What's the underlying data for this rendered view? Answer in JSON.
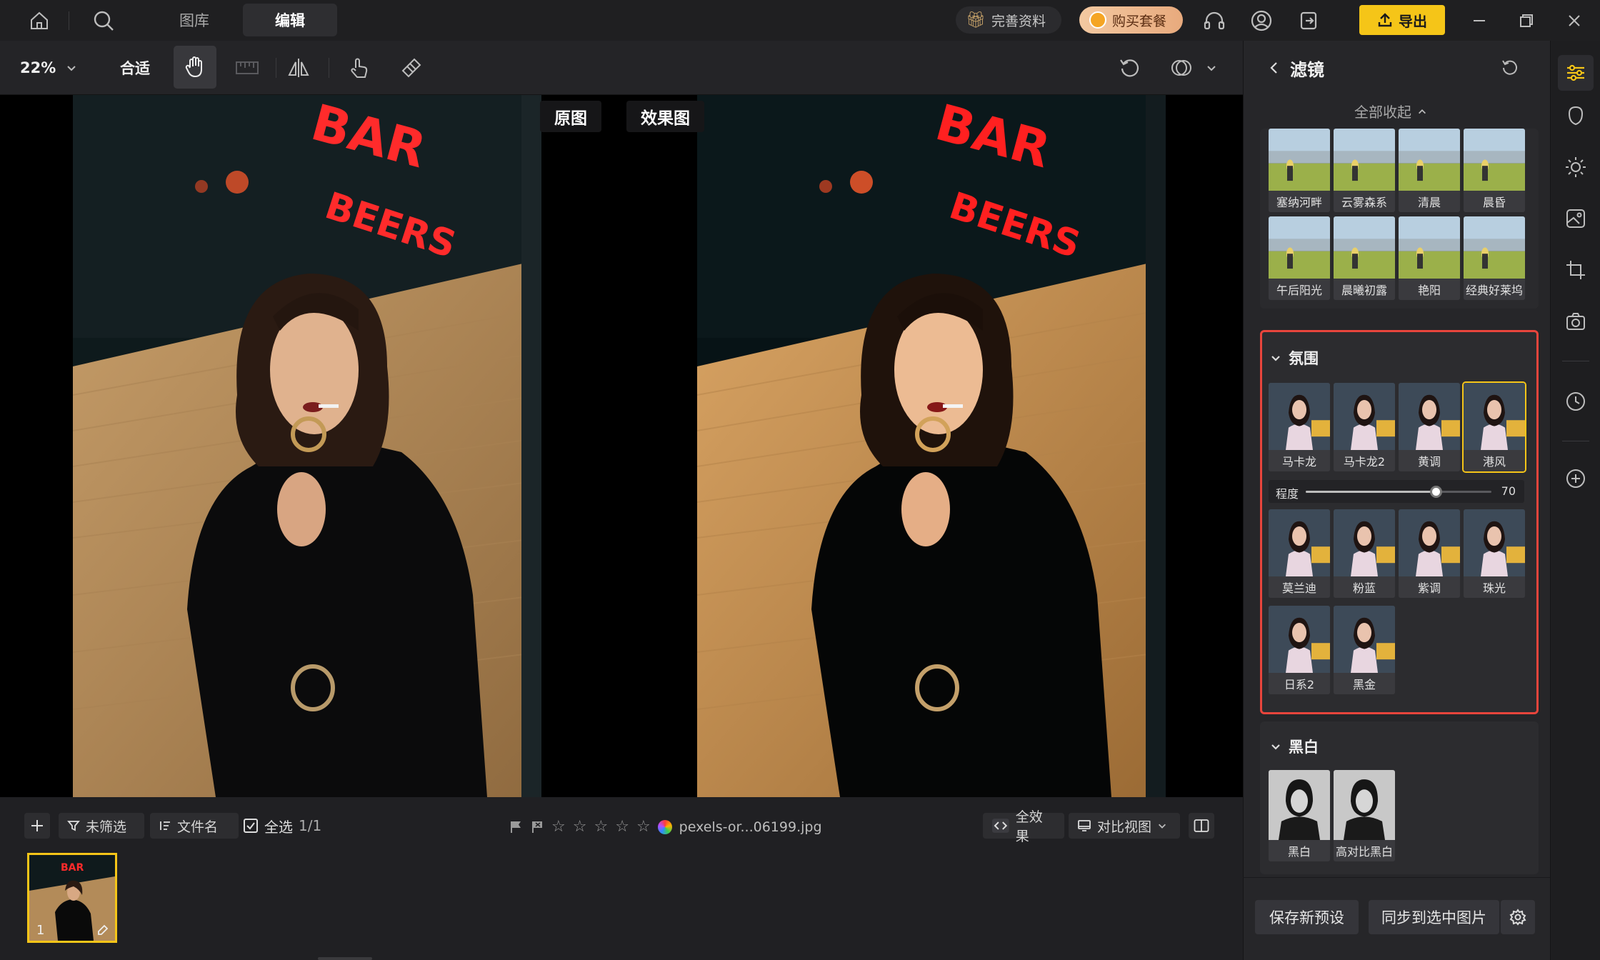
{
  "topbar": {
    "tabs": [
      {
        "label": "图库"
      },
      {
        "label": "编辑"
      }
    ],
    "complete_profile": "完善资料",
    "buy_package": "购买套餐",
    "export": "导出"
  },
  "toolbar": {
    "zoom": "22%",
    "fit": "合适"
  },
  "canvas": {
    "original_label": "原图",
    "effect_label": "效果图"
  },
  "bottom": {
    "unfiltered": "未筛选",
    "filename_sort": "文件名",
    "select_all": "全选",
    "count": "1/1",
    "filename": "pexels-or...06199.jpg",
    "all_effects": "全效果",
    "compare_view": "对比视图",
    "thumbnail_index": "1"
  },
  "panel": {
    "title": "滤镜",
    "collapse_all": "全部收起",
    "landscape_filters": [
      "塞纳河畔",
      "云雾森系",
      "清晨",
      "晨昏",
      "午后阳光",
      "晨曦初露",
      "艳阳",
      "经典好莱坞"
    ],
    "atmosphere": {
      "title": "氛围",
      "filters_row1": [
        "马卡龙",
        "马卡龙2",
        "黄调",
        "港风"
      ],
      "selected": "港风",
      "intensity_label": "程度",
      "intensity_value": "70",
      "intensity_fraction": 0.7,
      "filters_row2": [
        "莫兰迪",
        "粉蓝",
        "紫调",
        "珠光"
      ],
      "filters_row3": [
        "日系2",
        "黑金"
      ]
    },
    "bw": {
      "title": "黑白",
      "filters": [
        "黑白",
        "高对比黑白"
      ]
    },
    "save_preset": "保存新预设",
    "sync_to_selected": "同步到选中图片"
  },
  "colors": {
    "accent": "#f5c518",
    "highlight_border": "#e8453c",
    "panel_bg": "#262629"
  }
}
